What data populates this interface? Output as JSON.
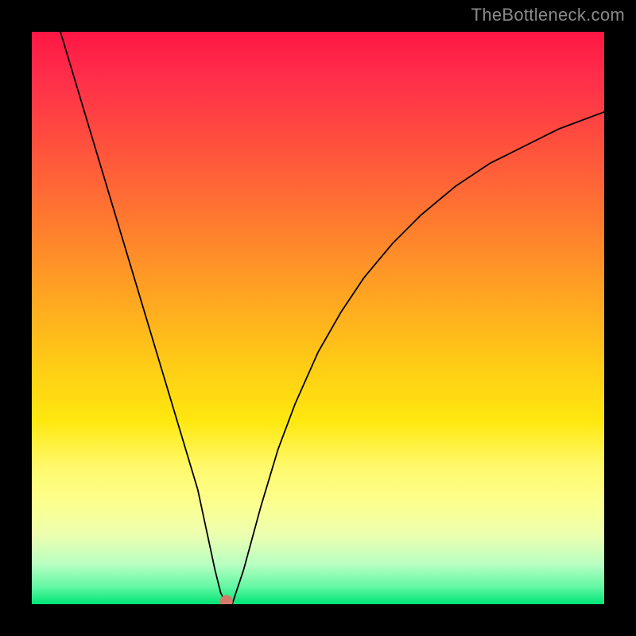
{
  "watermark": {
    "text": "TheBottleneck.com"
  },
  "chart_data": {
    "type": "line",
    "title": "",
    "xlabel": "",
    "ylabel": "",
    "xlim": [
      0,
      100
    ],
    "ylim": [
      0,
      100
    ],
    "grid": false,
    "legend": false,
    "background_gradient": {
      "top": "#ff1744",
      "upper_mid": "#ff8a2a",
      "mid": "#ffe80f",
      "lower_mid": "#fdff8d",
      "bottom": "#00e676"
    },
    "series": [
      {
        "name": "bottleneck-curve",
        "color": "#000000",
        "stroke_width": 1.8,
        "x": [
          5,
          8,
          11,
          14,
          17,
          20,
          23,
          26,
          29,
          32,
          33,
          34,
          35,
          37,
          40,
          43,
          46,
          50,
          54,
          58,
          63,
          68,
          74,
          80,
          86,
          92,
          100
        ],
        "y": [
          100,
          90,
          80,
          70,
          60,
          50,
          40,
          30,
          20,
          6,
          2,
          0,
          0,
          6,
          17,
          27,
          35,
          44,
          51,
          57,
          63,
          68,
          73,
          77,
          80,
          83,
          86
        ]
      }
    ],
    "points": [
      {
        "name": "min-point",
        "x": 34,
        "y": 0.5,
        "color": "#d47a6a",
        "radius": 8
      }
    ]
  }
}
